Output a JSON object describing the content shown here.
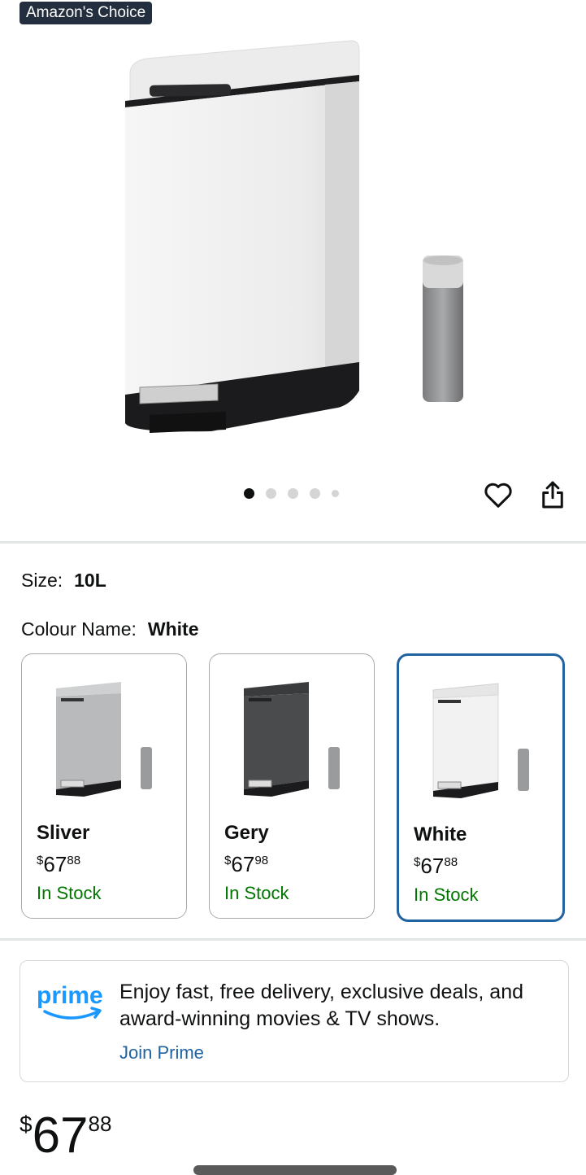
{
  "badge": "Amazon's Choice",
  "carousel": {
    "total": 5,
    "active_index": 0
  },
  "size": {
    "label": "Size:",
    "value": "10L"
  },
  "colour": {
    "label": "Colour Name:",
    "value": "White"
  },
  "variants": [
    {
      "name": "Sliver",
      "currency": "$",
      "whole": "67",
      "fraction": "88",
      "stock": "In Stock",
      "selected": false,
      "body_color": "#b9babb"
    },
    {
      "name": "Gery",
      "currency": "$",
      "whole": "67",
      "fraction": "98",
      "stock": "In Stock",
      "selected": false,
      "body_color": "#4a4b4d"
    },
    {
      "name": "White",
      "currency": "$",
      "whole": "67",
      "fraction": "88",
      "stock": "In Stock",
      "selected": true,
      "body_color": "#f2f2f2"
    }
  ],
  "prime": {
    "logo_text": "prime",
    "text": "Enjoy fast, free delivery, exclusive deals, and award-winning movies & TV shows.",
    "link": "Join Prime"
  },
  "price": {
    "currency": "$",
    "whole": "67",
    "fraction": "88"
  },
  "colors": {
    "accent_blue": "#2162a1",
    "in_stock_green": "#007600",
    "prime_blue": "#1a98ff"
  }
}
